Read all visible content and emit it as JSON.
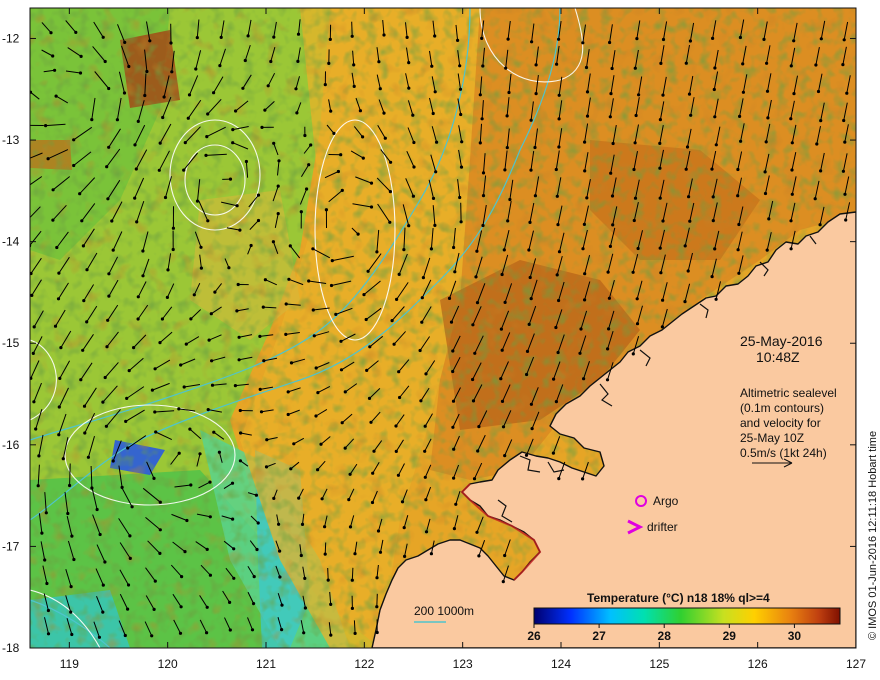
{
  "map": {
    "date": "25-May-2016",
    "time": "10:48Z",
    "altimetry_lines": [
      "Altimetric sealevel",
      "(0.1m contours)",
      "and velocity for",
      "25-May 10Z",
      "0.5m/s (1kt 24h)"
    ],
    "legend_argo": "Argo",
    "legend_drifter": "drifter",
    "bathy_label": "200  1000m",
    "colorbar_title": "Temperature (°C) n18 18% ql>=4",
    "colorbar_ticks": [
      "26",
      "27",
      "28",
      "29",
      "30"
    ],
    "colorbar_min": 26,
    "colorbar_max": 30.7,
    "credit": "© IMOS 01-Jun-2016 12:11:18 Hobart time",
    "x_ticks": [
      "119",
      "120",
      "121",
      "122",
      "123",
      "124",
      "125",
      "126",
      "127"
    ],
    "y_ticks": [
      "-12",
      "-13",
      "-14",
      "-15",
      "-16",
      "-17",
      "-18"
    ],
    "lon_range": [
      118.6,
      127.0
    ],
    "lat_range": [
      -18.0,
      -11.7
    ],
    "colors": {
      "land": "#fac9a0",
      "coast": "#111111",
      "bathy": "#4fc4cc",
      "contour": "#ffffff",
      "arrow": "#000000",
      "argo": "#e000e0",
      "drifter": "#e000e0"
    },
    "icons": {
      "argo": "magenta-circle-icon",
      "drifter": "magenta-chevron-icon"
    }
  }
}
